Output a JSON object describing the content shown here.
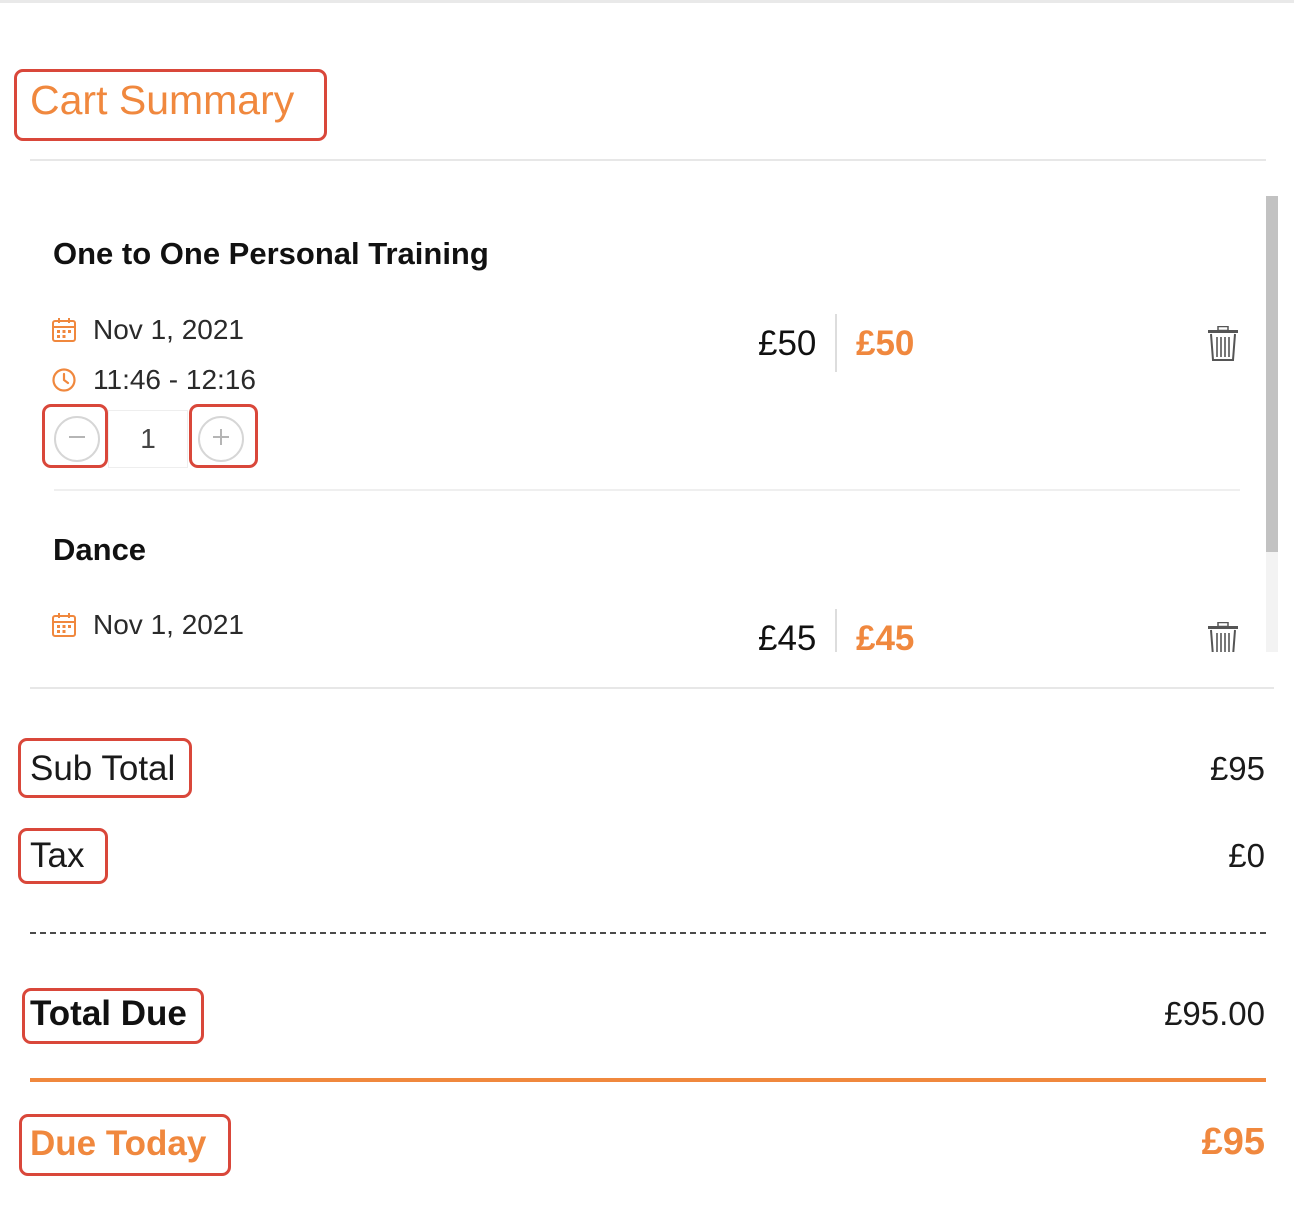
{
  "cart": {
    "title": "Cart Summary",
    "items": [
      {
        "name": "One to One Personal Training",
        "date": "Nov 1, 2021",
        "time": "11:46 - 12:16",
        "quantity": "1",
        "price": "£50",
        "discounted_price": "£50"
      },
      {
        "name": "Dance",
        "date": "Nov 1, 2021",
        "price": "£45",
        "discounted_price": "£45"
      }
    ]
  },
  "summary": {
    "subtotal_label": "Sub Total",
    "subtotal_value": "£95",
    "tax_label": "Tax",
    "tax_value": "£0",
    "total_due_label": "Total Due",
    "total_due_value": "£95.00",
    "due_today_label": "Due Today",
    "due_today_value": "£95"
  },
  "icons": {
    "calendar": "calendar-icon",
    "clock": "clock-icon",
    "trash": "trash-icon",
    "minus": "minus-icon",
    "plus": "plus-icon"
  },
  "colors": {
    "accent": "#f0883e",
    "highlight": "#d9473a"
  }
}
